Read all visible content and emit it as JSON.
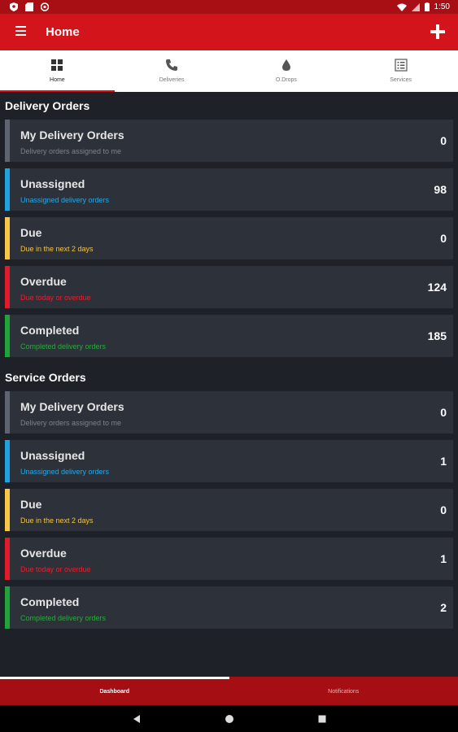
{
  "status_bar": {
    "time": "1:50"
  },
  "app_bar": {
    "title": "Home"
  },
  "tabs": [
    {
      "label": "Home",
      "icon": "grid-icon",
      "active": true
    },
    {
      "label": "Deliveries",
      "icon": "phone-icon",
      "active": false
    },
    {
      "label": "O.Drops",
      "icon": "drop-icon",
      "active": false
    },
    {
      "label": "Services",
      "icon": "list-icon",
      "active": false
    }
  ],
  "delivery_orders": {
    "title": "Delivery Orders",
    "items": [
      {
        "title": "My Delivery Orders",
        "subtitle": "Delivery orders assigned to me",
        "count": "0",
        "color": "#5f6570",
        "sub_color": "#7e838c"
      },
      {
        "title": "Unassigned",
        "subtitle": "Unassigned delivery orders",
        "count": "98",
        "color": "#1ea4e0",
        "sub_color": "#28a9e6"
      },
      {
        "title": "Due",
        "subtitle": "Due in the next 2 days",
        "count": "0",
        "color": "#f7c646",
        "sub_color": "#f3c443"
      },
      {
        "title": "Overdue",
        "subtitle": "Due today or overdue",
        "count": "124",
        "color": "#e11b2a",
        "sub_color": "#e3222f"
      },
      {
        "title": "Completed",
        "subtitle": "Completed delivery orders",
        "count": "185",
        "color": "#1fa438",
        "sub_color": "#2aab3e"
      }
    ]
  },
  "service_orders": {
    "title": "Service Orders",
    "items": [
      {
        "title": "My Delivery Orders",
        "subtitle": "Delivery orders assigned to me",
        "count": "0",
        "color": "#5f6570",
        "sub_color": "#7e838c"
      },
      {
        "title": "Unassigned",
        "subtitle": "Unassigned delivery orders",
        "count": "1",
        "color": "#1ea4e0",
        "sub_color": "#28a9e6"
      },
      {
        "title": "Due",
        "subtitle": "Due in the next 2 days",
        "count": "0",
        "color": "#f7c646",
        "sub_color": "#f3c443"
      },
      {
        "title": "Overdue",
        "subtitle": "Due today or overdue",
        "count": "1",
        "color": "#e11b2a",
        "sub_color": "#e3222f"
      },
      {
        "title": "Completed",
        "subtitle": "Completed delivery orders",
        "count": "2",
        "color": "#1fa438",
        "sub_color": "#2aab3e"
      }
    ]
  },
  "bottom_nav": [
    {
      "label": "Dashboard",
      "active": true
    },
    {
      "label": "Notifications",
      "active": false
    }
  ]
}
